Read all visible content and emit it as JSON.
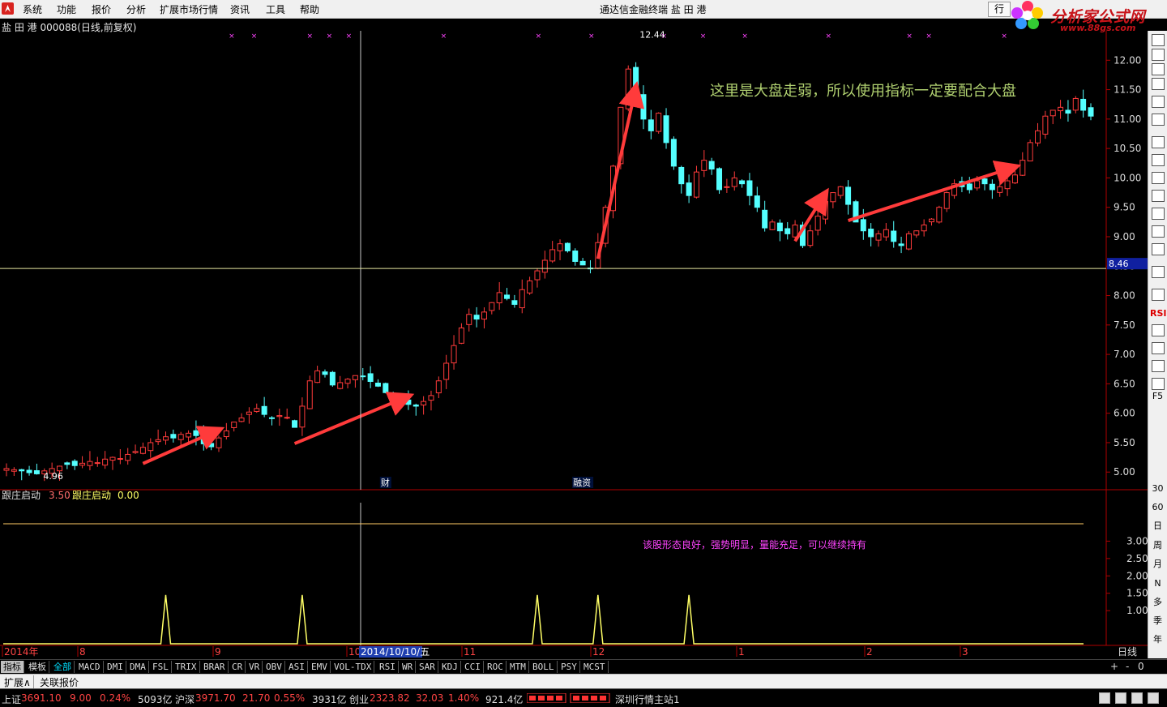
{
  "menu": {
    "items": [
      "系统",
      "功能",
      "报价",
      "分析",
      "扩展市场行情",
      "资讯",
      "工具",
      "帮助"
    ],
    "center_title": "通达信金融终端   盐 田 港",
    "right_button": "行"
  },
  "brand": {
    "name": "分析家公式网",
    "site": "www.88gs.com"
  },
  "stock": {
    "header": "盐 田 港  000088(日线,前复权)"
  },
  "chart_data": [
    {
      "type": "candlestick",
      "title": "",
      "y_ticks": [
        12.0,
        11.5,
        11.0,
        10.5,
        10.0,
        9.5,
        9.0,
        8.5,
        8.0,
        7.5,
        7.0,
        6.5,
        6.0,
        5.5,
        5.0
      ],
      "ylim": [
        4.7,
        12.5
      ],
      "price_marker": "8.46",
      "high_label": "12.44",
      "low_label": "4.96",
      "annotation": "这里是大盘走弱，所以使用指标一定要配合大盘",
      "event_labels": [
        {
          "text": "财",
          "bar": 50
        },
        {
          "text": "融资",
          "bar": 76
        }
      ],
      "sample": "approximate daily closes, 2014-07 .. 2015-03",
      "closes": [
        5.06,
        5.04,
        5.02,
        4.99,
        4.97,
        5.02,
        5.06,
        5.1,
        5.13,
        5.11,
        5.15,
        5.18,
        5.16,
        5.22,
        5.25,
        5.23,
        5.3,
        5.35,
        5.42,
        5.5,
        5.55,
        5.6,
        5.58,
        5.64,
        5.66,
        5.62,
        5.48,
        5.43,
        5.58,
        5.7,
        5.85,
        5.92,
        6.02,
        6.08,
        5.98,
        5.92,
        5.96,
        5.93,
        5.76,
        6.12,
        6.55,
        6.72,
        6.66,
        6.48,
        6.52,
        6.58,
        6.64,
        6.62,
        6.54,
        6.46,
        6.35,
        6.25,
        6.22,
        6.15,
        6.12,
        6.2,
        6.3,
        6.55,
        6.85,
        7.15,
        7.45,
        7.68,
        7.6,
        7.72,
        7.88,
        8.05,
        7.95,
        7.85,
        8.1,
        8.25,
        8.42,
        8.6,
        8.78,
        8.88,
        8.76,
        8.58,
        8.52,
        8.46,
        8.9,
        9.5,
        10.2,
        11.2,
        11.85,
        11.4,
        11.0,
        10.8,
        11.1,
        10.6,
        10.2,
        9.9,
        9.7,
        10.1,
        10.3,
        10.15,
        9.8,
        9.85,
        10.0,
        9.9,
        9.7,
        9.5,
        9.15,
        9.25,
        9.1,
        9.05,
        9.2,
        8.85,
        9.1,
        9.35,
        9.6,
        9.75,
        9.85,
        9.55,
        9.25,
        9.1,
        9.0,
        9.05,
        9.12,
        8.92,
        8.85,
        9.05,
        9.1,
        9.2,
        9.3,
        9.5,
        9.75,
        9.9,
        9.85,
        9.8,
        9.95,
        9.9,
        9.8,
        9.85,
        9.95,
        10.05,
        10.3,
        10.6,
        10.8,
        11.05,
        11.15,
        11.2,
        11.1,
        11.35,
        11.15,
        11.05
      ]
    },
    {
      "type": "line",
      "title": "跟庄启动",
      "legend": [
        {
          "name": "跟庄启动",
          "value": "3.50"
        },
        {
          "name": "跟庄启动",
          "value": "0.00"
        }
      ],
      "y_ticks": [
        3.0,
        2.5,
        2.0,
        1.5,
        1.0
      ],
      "ylim": [
        0,
        3.5
      ],
      "reference_level": 3.5,
      "annotation": "该股形态良好，强势明显，量能充足，可以继续持有",
      "spike_positions": [
        21,
        39,
        70,
        78,
        90
      ]
    }
  ],
  "x_axis": {
    "labels": [
      "2014年",
      "8",
      "9",
      "10",
      "11",
      "12",
      "1",
      "2",
      "3"
    ],
    "cursor_date": "2014/10/10/五",
    "period": "日线"
  },
  "sidebar": {
    "labels": [
      "RSI",
      "F5",
      "30",
      "60",
      "日",
      "周",
      "月",
      "N",
      "多",
      "季",
      "年"
    ]
  },
  "indicator_tabs": {
    "items": [
      "指标",
      "模板",
      "全部",
      "MACD",
      "DMI",
      "DMA",
      "FSL",
      "TRIX",
      "BRAR",
      "CR",
      "VR",
      "OBV",
      "ASI",
      "EMV",
      "VOL-TDX",
      "RSI",
      "WR",
      "SAR",
      "KDJ",
      "CCI",
      "ROC",
      "MTM",
      "BOLL",
      "PSY",
      "MCST"
    ],
    "controls": [
      "+",
      "-",
      "0"
    ]
  },
  "ext_tabs": [
    "扩展∧",
    "关联报价"
  ],
  "status_bar": {
    "sh_label": "上证",
    "sh_value": "3691.10",
    "sh_change": "9.00",
    "sh_pct": "0.24%",
    "sh_vol": "5093亿",
    "hs_label": "沪深",
    "hs_value": "3971.70",
    "hs_change": "21.70",
    "hs_pct": "0.55%",
    "hs_vol": "3931亿",
    "cy_label": "创业",
    "cy_value": "2323.82",
    "cy_change": "32.03",
    "cy_pct": "1.40%",
    "cy_vol": "921.4亿",
    "server": "深圳行情主站1"
  },
  "colors": {
    "up": "#ff3b3b",
    "down": "#54ffff",
    "grid": "#b00000",
    "indicator": "#ffff66",
    "annotation": "#b0d070",
    "note": "#ff44ff",
    "cursor": "#c8c8c8",
    "marker": "#ff44ff"
  }
}
